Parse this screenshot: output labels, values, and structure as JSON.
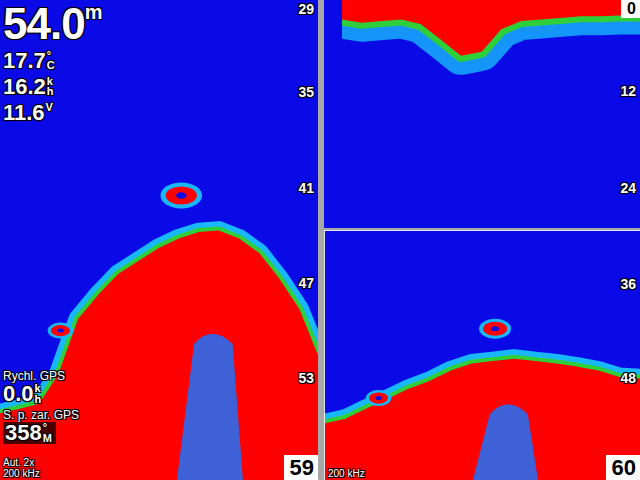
{
  "left_panel": {
    "depth": {
      "value": "54.0",
      "unit": "m"
    },
    "readings": [
      {
        "value": "17.7",
        "unit": "°C"
      },
      {
        "value": "16.2",
        "unit": "kh"
      },
      {
        "value": "11.6",
        "unit": "V"
      }
    ],
    "scale": [
      {
        "text": "29",
        "depth": 29
      },
      {
        "text": "35",
        "depth": 35
      },
      {
        "text": "41",
        "depth": 41
      },
      {
        "text": "47",
        "depth": 47
      },
      {
        "text": "53",
        "depth": 53
      }
    ],
    "scale_end": "59",
    "gps_speed": {
      "label": "Rychl. GPS",
      "value": "0.0",
      "unit": "kh"
    },
    "gps_heading": {
      "label": "S. p. zar. GPS",
      "value": "358",
      "unit": "°M"
    },
    "zoom": "Aut. 2x",
    "frequency": "200 kHz",
    "range": [
      29.2,
      59.4
    ],
    "bottom_depths": [
      55.3,
      55.0,
      54.7,
      52.8,
      49.3,
      47.8,
      46.5,
      45.7,
      44.9,
      44.3,
      43.9,
      43.8,
      44.3,
      45.2,
      46.8,
      48.7,
      51.8
    ],
    "fish": [
      {
        "depth": 41.5,
        "position": 0.57,
        "size": 1.3
      },
      {
        "depth": 50.0,
        "position": 0.19,
        "size": 0.8
      }
    ]
  },
  "top_right_panel": {
    "scale_start": "0",
    "scale": [
      {
        "text": "12",
        "depth": 12
      },
      {
        "text": "24",
        "depth": 24
      }
    ],
    "range": [
      0.7,
      29.0
    ],
    "surface_clutter_depths": [
      3.0,
      3.4,
      3.2,
      3.0,
      3.6,
      5.5,
      7.5,
      7.0,
      4.2,
      3.2,
      3.0,
      2.8,
      2.6,
      2.6,
      2.5,
      2.5
    ]
  },
  "bottom_right_panel": {
    "scale": [
      {
        "text": "36",
        "depth": 36
      },
      {
        "text": "48",
        "depth": 48
      }
    ],
    "scale_end": "60",
    "frequency": "200 kHz",
    "range": [
      29.3,
      60.9
    ],
    "bottom_depths": [
      53.9,
      53.3,
      52.0,
      50.8,
      49.5,
      48.5,
      47.2,
      46.3,
      46.0,
      45.7,
      46.0,
      46.3,
      46.7,
      47.2,
      48.0,
      48.2
    ],
    "fish": [
      {
        "depth": 41.7,
        "position": 0.54,
        "size": 1.0
      },
      {
        "depth": 50.5,
        "position": 0.17,
        "size": 0.8
      }
    ]
  }
}
